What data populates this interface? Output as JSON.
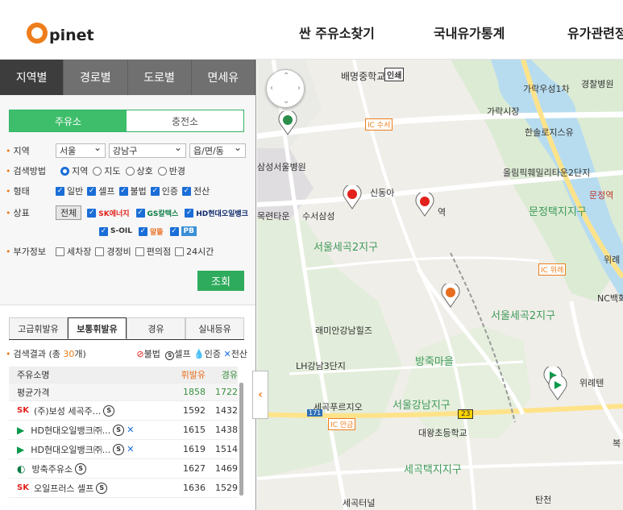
{
  "header": {
    "logo_letter": "O",
    "logo_text": "pinet",
    "menu": [
      "싼 주유소찾기",
      "국내유가통계",
      "유가관련정"
    ]
  },
  "panel": {
    "top_tabs": [
      "지역별",
      "경로별",
      "도로별",
      "면세유"
    ],
    "sub_tabs": [
      "주유소",
      "충전소"
    ],
    "region": {
      "label": "지역",
      "sido": "서울",
      "sigungu": "강남구",
      "dong": "읍/면/동"
    },
    "method": {
      "label": "검색방법",
      "options": [
        "지역",
        "지도",
        "상호",
        "반경"
      ]
    },
    "type": {
      "label": "형태",
      "options": [
        "일반",
        "셀프",
        "불법",
        "인증",
        "전산"
      ]
    },
    "brand": {
      "label": "상표",
      "all": "전체",
      "brands": [
        "SK에너지",
        "GS칼텍스",
        "HD현대오일뱅크",
        "S-OIL",
        "알뜰",
        "PB"
      ]
    },
    "extra": {
      "label": "부가정보",
      "options": [
        "세차장",
        "경정비",
        "편의점",
        "24시간"
      ]
    },
    "search_button": "조회"
  },
  "list": {
    "fuel_tabs": [
      "고급휘발유",
      "보통휘발유",
      "경유",
      "실내등유"
    ],
    "result_prefix": "검색결과 (총",
    "result_count": "30",
    "result_suffix": "개)",
    "legend": [
      "불법",
      "셀프",
      "인증",
      "전산"
    ],
    "columns": [
      "주유소명",
      "휘발유",
      "경유"
    ],
    "average": {
      "label": "평균가격",
      "gasoline": "1858",
      "diesel": "1722"
    },
    "rows": [
      {
        "brand": "SK",
        "name": "(주)보성 세곡주...",
        "gasoline": "1592",
        "diesel": "1432"
      },
      {
        "brand": "HD",
        "name": "HD현대오일뱅크㈜...",
        "gasoline": "1615",
        "diesel": "1438"
      },
      {
        "brand": "HD",
        "name": "HD현대오일뱅크㈜...",
        "gasoline": "1619",
        "diesel": "1514"
      },
      {
        "brand": "GS",
        "name": "방축주유소",
        "gasoline": "1627",
        "diesel": "1469"
      },
      {
        "brand": "SK",
        "name": "오일프러스 셀프",
        "gasoline": "1636",
        "diesel": "1529"
      }
    ]
  },
  "map": {
    "labels": [
      "배명중학교",
      "인쇄",
      "가락우성1차",
      "경찰병원",
      "가락시장",
      "한솔로지스유",
      "삼성서울병원",
      "올림픽훼밀리타운2단지",
      "문정역",
      "신동아",
      "목련타운",
      "수서삼성",
      "역",
      "문정택지지구",
      "서울세곡2지구",
      "위례",
      "NC백화",
      "서울세곡2지구",
      "래미안강남힐즈",
      "LH강남3단지",
      "방죽마을",
      "위례텐",
      "세곡푸르지오",
      "서울강남지구",
      "대왕초등학교",
      "세곡택지지구",
      "복",
      "세곡터널",
      "탄천"
    ],
    "ic_labels": [
      "IC 수서",
      "IC 위례",
      "IC 안금"
    ],
    "road_numbers": [
      "171",
      "23"
    ]
  }
}
